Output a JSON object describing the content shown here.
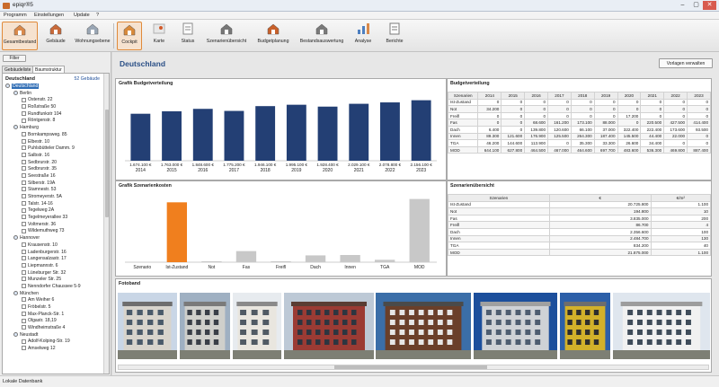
{
  "window": {
    "title": "epiqr®5",
    "controls": [
      "–",
      "▢",
      "✕"
    ]
  },
  "menu": [
    "Programm",
    "Einstellungen",
    "Update",
    "?"
  ],
  "toolbar": [
    {
      "label": "Gesamtbestand",
      "icon": "portfolio-icon",
      "active": true
    },
    {
      "label": "Gebäude",
      "icon": "building-icon",
      "active": false
    },
    {
      "label": "Wohnungsebene",
      "icon": "apartment-icon",
      "active": false
    },
    {
      "label": "Cockpit",
      "icon": "cockpit-icon",
      "active": true
    },
    {
      "label": "Karte",
      "icon": "map-icon",
      "active": false
    },
    {
      "label": "Status",
      "icon": "status-icon",
      "active": false
    },
    {
      "label": "Szenarienübersicht",
      "icon": "scenario-icon",
      "active": false
    },
    {
      "label": "Budgetplanung",
      "icon": "budget-icon",
      "active": false
    },
    {
      "label": "Bestandsauswertung",
      "icon": "inventory-icon",
      "active": false
    },
    {
      "label": "Analyse",
      "icon": "analysis-icon",
      "active": false
    },
    {
      "label": "Berichte",
      "icon": "reports-icon",
      "active": false
    }
  ],
  "left": {
    "filter_label": "Filter",
    "tabs": [
      "Gebäudeliste",
      "Baumstruktur"
    ],
    "root": "Deutschland",
    "count": "52 Gebäude",
    "tree": [
      {
        "t": "Deutschland",
        "l": 0,
        "k": "city",
        "sel": true
      },
      {
        "t": "Berlin",
        "l": 1,
        "k": "city"
      },
      {
        "t": "Ostenstr. 22",
        "l": 2,
        "k": "house"
      },
      {
        "t": "Roßstraße 50",
        "l": 2,
        "k": "house"
      },
      {
        "t": "Rundfunkstr 104",
        "l": 2,
        "k": "house"
      },
      {
        "t": "Röntgenstr. 8",
        "l": 2,
        "k": "house"
      },
      {
        "t": "Hamburg",
        "l": 1,
        "k": "city"
      },
      {
        "t": "Bornkampsweg. 85",
        "l": 2,
        "k": "house"
      },
      {
        "t": "Elbestr. 10",
        "l": 2,
        "k": "house"
      },
      {
        "t": "Puhlsbütteler Damm. 9",
        "l": 2,
        "k": "house"
      },
      {
        "t": "Salbstr. 16",
        "l": 2,
        "k": "house"
      },
      {
        "t": "Sedbrurstr. 20",
        "l": 2,
        "k": "house"
      },
      {
        "t": "Sedbrurstr. 35",
        "l": 2,
        "k": "house"
      },
      {
        "t": "Seestraße 16",
        "l": 2,
        "k": "house"
      },
      {
        "t": "Silberstr. 19A",
        "l": 2,
        "k": "house"
      },
      {
        "t": "Stamnestr. 53",
        "l": 2,
        "k": "house"
      },
      {
        "t": "Stromeyerstr. 5A",
        "l": 2,
        "k": "house"
      },
      {
        "t": "Talstr. 14-16",
        "l": 2,
        "k": "house"
      },
      {
        "t": "Tegelweg 2A",
        "l": 2,
        "k": "house"
      },
      {
        "t": "Tegelmeyerallee 33",
        "l": 2,
        "k": "house"
      },
      {
        "t": "Voltmerstr. 36",
        "l": 2,
        "k": "house"
      },
      {
        "t": "Wildemuthweg 73",
        "l": 2,
        "k": "house"
      },
      {
        "t": "Hannover",
        "l": 1,
        "k": "city"
      },
      {
        "t": "Krausenstr. 10",
        "l": 2,
        "k": "house"
      },
      {
        "t": "Ladenburgerstr. 16",
        "l": 2,
        "k": "house"
      },
      {
        "t": "Langensalzastr. 17",
        "l": 2,
        "k": "house"
      },
      {
        "t": "Liepmannstr. 6",
        "l": 2,
        "k": "house"
      },
      {
        "t": "Lüneburger Str. 32",
        "l": 2,
        "k": "house"
      },
      {
        "t": "Munzeler Str. 25",
        "l": 2,
        "k": "house"
      },
      {
        "t": "Nenndorfer Chaussee 5-9",
        "l": 2,
        "k": "house"
      },
      {
        "t": "München",
        "l": 1,
        "k": "city"
      },
      {
        "t": "Am Weiher 6",
        "l": 2,
        "k": "house"
      },
      {
        "t": "Fröbelstr. 5",
        "l": 2,
        "k": "house"
      },
      {
        "t": "Max-Planck-Str. 1",
        "l": 2,
        "k": "house"
      },
      {
        "t": "Olgastr. 18,19",
        "l": 2,
        "k": "house"
      },
      {
        "t": "Windheimstraße 4",
        "l": 2,
        "k": "house"
      },
      {
        "t": "Neustadt",
        "l": 1,
        "k": "city"
      },
      {
        "t": "Adolf-Kolping-Str. 19",
        "l": 2,
        "k": "house"
      },
      {
        "t": "Amselweg 12",
        "l": 2,
        "k": "house"
      }
    ]
  },
  "main": {
    "title": "Deutschland",
    "manage_label": "Vorlagen verwalten",
    "budget_chart_title": "Grafik Budgetverteilung",
    "scen_chart_title": "Grafik Szenarienkosten",
    "budget_table_title": "Budgetverteilung",
    "scen_table_title": "Szenarienübersicht",
    "photo_title": "Fotoband"
  },
  "chart_data": [
    {
      "type": "bar",
      "title": "Grafik Budgetverteilung",
      "categories": [
        "2014",
        "2015",
        "2016",
        "2017",
        "2018",
        "2019",
        "2020",
        "2021",
        "2022",
        "2023"
      ],
      "values": [
        1674100,
        1763000,
        1848600,
        1775200,
        1946100,
        1995100,
        1928400,
        2029100,
        2078800,
        2156100
      ],
      "labels": [
        "1.674.100 €",
        "1.763.000 €",
        "1.848.600 €",
        "1.775.200 €",
        "1.946.100 €",
        "1.995.100 €",
        "1.928.400 €",
        "2.029.100 €",
        "2.078.800 €",
        "2.156.100 €"
      ],
      "color": "#233f74"
    },
    {
      "type": "bar",
      "title": "Grafik Szenarienkosten",
      "categories": [
        "Szenario",
        "Ist-Zustand",
        "Not",
        "Fas",
        "Freifl",
        "Dach",
        "Innen",
        "TGA",
        "MOD"
      ],
      "values": [
        0,
        20725800,
        194800,
        3835000,
        86700,
        2356600,
        2484700,
        834200,
        21875000
      ],
      "colors": [
        "#c8c8c8",
        "#f07f1e",
        "#c8c8c8",
        "#c8c8c8",
        "#c8c8c8",
        "#c8c8c8",
        "#c8c8c8",
        "#c8c8c8",
        "#c8c8c8"
      ]
    }
  ],
  "budget_table": {
    "header": [
      "Szenarien",
      "2014",
      "2015",
      "2016",
      "2017",
      "2018",
      "2019",
      "2020",
      "2021",
      "2022",
      "2023"
    ],
    "rows": [
      [
        "Ist-Zustand",
        "0",
        "0",
        "0",
        "0",
        "0",
        "0",
        "0",
        "0",
        "0",
        "0"
      ],
      [
        "Not",
        "34.200",
        "0",
        "0",
        "0",
        "0",
        "0",
        "0",
        "0",
        "0",
        "0"
      ],
      [
        "Freifl",
        "0",
        "0",
        "0",
        "0",
        "0",
        "0",
        "17.200",
        "0",
        "0",
        "0"
      ],
      [
        "Fas",
        "0",
        "0",
        "68.600",
        "161.200",
        "173.100",
        "88.000",
        "0",
        "220.500",
        "427.500",
        "414.400"
      ],
      [
        "Dach",
        "6.400",
        "0",
        "139.800",
        "120.600",
        "66.100",
        "37.000",
        "322.400",
        "222.400",
        "173.600",
        "93.500"
      ],
      [
        "Innen",
        "89.300",
        "121.600",
        "176.900",
        "125.500",
        "264.300",
        "187.400",
        "145.500",
        "44.400",
        "22.000",
        "0"
      ],
      [
        "TGA",
        "46.200",
        "144.600",
        "113.900",
        "0",
        "35.300",
        "33.300",
        "26.600",
        "34.400",
        "0",
        "0"
      ],
      [
        "MOD",
        "644.100",
        "627.800",
        "464.500",
        "467.000",
        "464.600",
        "697.700",
        "483.600",
        "536.300",
        "469.800",
        "887.400"
      ]
    ]
  },
  "scen_table": {
    "header": [
      "Szenarien",
      "€",
      "€/m²"
    ],
    "rows": [
      [
        "Ist-Zustand",
        "20.725.800",
        "1.100"
      ],
      [
        "Not",
        "194.800",
        "10"
      ],
      [
        "Fas",
        "3.835.000",
        "200"
      ],
      [
        "Freifl",
        "86.700",
        "4"
      ],
      [
        "Dach",
        "2.356.600",
        "100"
      ],
      [
        "Innen",
        "2.484.700",
        "130"
      ],
      [
        "TGA",
        "834.200",
        "40"
      ],
      [
        "MOD",
        "21.875.000",
        "1.100"
      ]
    ]
  },
  "photos": [
    {
      "sky": "#c9d6e6",
      "wall": "#d8d4cc",
      "roof": "#6e6e6e",
      "win": "#4a5a6a"
    },
    {
      "sky": "#9fb0c2",
      "wall": "#cfcfcb",
      "roof": "#7a7a7a",
      "win": "#3a3f48"
    },
    {
      "sky": "#e7ebef",
      "wall": "#e9e6df",
      "roof": "#8a8a8a",
      "win": "#505a64"
    },
    {
      "sky": "#bdc9d6",
      "wall": "#9b3b34",
      "roof": "#5a3d34",
      "win": "#2d3540"
    },
    {
      "sky": "#3b6ea8",
      "wall": "#6a3f2a",
      "roof": "#4a4a4a",
      "win": "#e6e6e6"
    },
    {
      "sky": "#1c4f9c",
      "wall": "#cfd2d6",
      "roof": "#a0a0a0",
      "win": "#4e5d70"
    },
    {
      "sky": "#2c5fa8",
      "wall": "#d2b12a",
      "roof": "#6d6d6d",
      "win": "#2e2e2e"
    },
    {
      "sky": "#dfe6ee",
      "wall": "#f1f1f1",
      "roof": "#9d9d9d",
      "win": "#3f4c5a"
    }
  ],
  "status": "Lokale Datenbank"
}
